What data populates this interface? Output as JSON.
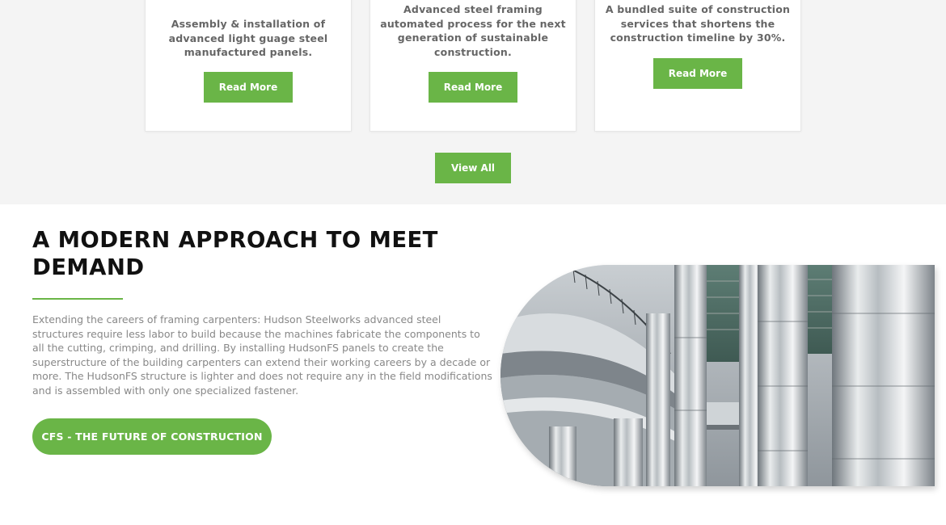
{
  "services": {
    "cards": [
      {
        "text": "Assembly & installation of advanced light guage steel manufactured panels.",
        "button_label": "Read More"
      },
      {
        "text": "Advanced steel framing automated process for the next generation of sustainable construction.",
        "button_label": "Read More"
      },
      {
        "text": "A bundled suite of construction services that shortens the construction timeline by 30%.",
        "button_label": "Read More"
      }
    ],
    "view_all_label": "View All"
  },
  "approach": {
    "heading_line1": "A MODERN APPROACH TO MEET",
    "heading_line2": "DEMAND",
    "body": "Extending the careers of framing carpenters: Hudson Steelworks advanced steel structures require less labor to build because the machines fabricate the components to all the cutting, crimping, and drilling. By installing HudsonFS panels to create the superstructure of the building carpenters can extend their working careers by a decade or more. The HudsonFS structure is lighter and does not require any in the field modifications and is assembled with only one specialized fastener.",
    "cta_label": "CFS - THE FUTURE OF CONSTRUCTION"
  },
  "colors": {
    "accent": "#6ab547",
    "band_background": "#f4f4f4",
    "heading": "#111111",
    "body_text": "#888888"
  }
}
